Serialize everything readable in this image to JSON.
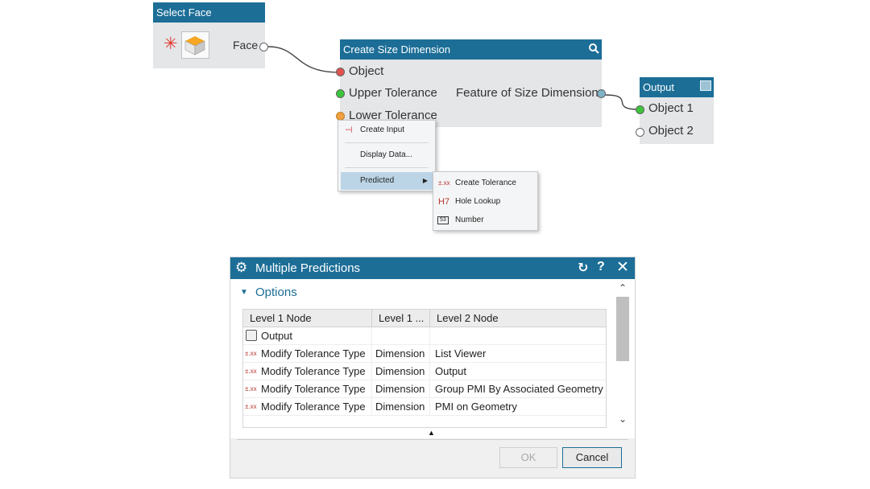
{
  "nodes": {
    "select_face": {
      "title": "Select Face",
      "port_face": "Face"
    },
    "create_size": {
      "title": "Create Size Dimension",
      "inputs": [
        "Object",
        "Upper Tolerance",
        "Lower Tolerance"
      ],
      "output": "Feature of Size Dimension"
    },
    "output": {
      "title": "Output",
      "inputs": [
        "Object 1",
        "Object 2"
      ]
    }
  },
  "context_menu": {
    "items": [
      "Create Input",
      "Display Data...",
      "Predicted"
    ],
    "submenu": [
      {
        "glyph": "±.xx",
        "label": "Create Tolerance"
      },
      {
        "glyph": "H7",
        "label": "Hole Lookup"
      },
      {
        "glyph": "53",
        "label": "Number"
      }
    ]
  },
  "dialog": {
    "title": "Multiple Predictions",
    "section": "Options",
    "columns": [
      "Level 1 Node",
      "Level 1 ...",
      "Level 2 Node"
    ],
    "rows": [
      {
        "icon": "output-node-icon",
        "level1": "Output",
        "level1b": "",
        "level2": ""
      },
      {
        "icon": "tolerance-icon",
        "icon_text": "±.xx",
        "level1": "Modify Tolerance Type",
        "level1b": "Dimension",
        "level2": "List Viewer"
      },
      {
        "icon": "tolerance-icon",
        "icon_text": "±.xx",
        "level1": "Modify Tolerance Type",
        "level1b": "Dimension",
        "level2": "Output"
      },
      {
        "icon": "tolerance-icon",
        "icon_text": "±.xx",
        "level1": "Modify Tolerance Type",
        "level1b": "Dimension",
        "level2": "Group PMI By Associated Geometry"
      },
      {
        "icon": "tolerance-icon",
        "icon_text": "±.xx",
        "level1": "Modify Tolerance Type",
        "level1b": "Dimension",
        "level2": "PMI on Geometry"
      }
    ],
    "ok_label": "OK",
    "cancel_label": "Cancel"
  },
  "colors": {
    "title_bar": "#1c6e97",
    "node_body": "#e4e6e8",
    "port_red": "#e0534e",
    "port_green": "#3cc43c",
    "port_orange": "#f0a040",
    "port_teal": "#7fb3c8",
    "menu_highlight": "#bcd5e6"
  }
}
